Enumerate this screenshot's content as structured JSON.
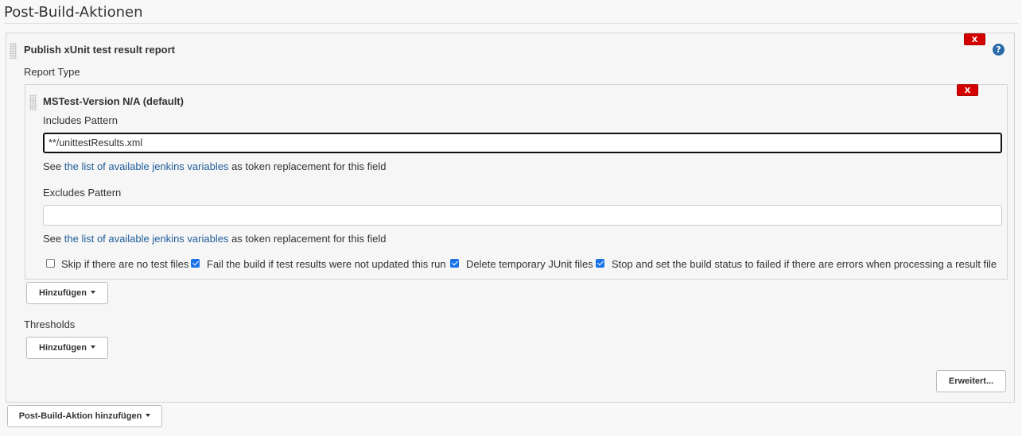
{
  "section": {
    "title": "Post-Build-Aktionen"
  },
  "publisher": {
    "title": "Publish xUnit test result report",
    "delete_label": "X",
    "help_label": "?",
    "report_type_label": "Report Type",
    "report": {
      "title": "MSTest-Version N/A (default)",
      "delete_label": "X",
      "includes": {
        "label": "Includes Pattern",
        "value": "**/unittestResults.xml",
        "hint_prefix": "See",
        "hint_link": "the list of available jenkins variables",
        "hint_suffix": "as token replacement for this field"
      },
      "excludes": {
        "label": "Excludes Pattern",
        "value": "",
        "hint_prefix": "See",
        "hint_link": "the list of available jenkins variables",
        "hint_suffix": "as token replacement for this field"
      },
      "options": [
        {
          "label": "Skip if there are no test files",
          "checked": false
        },
        {
          "label": "Fail the build if test results were not updated this run",
          "checked": true
        },
        {
          "label": "Delete temporary JUnit files",
          "checked": true
        },
        {
          "label": "Stop and set the build status to failed if there are errors when processing a result file",
          "checked": true
        }
      ]
    },
    "report_add_label": "Hinzufügen",
    "thresholds_label": "Thresholds",
    "thresholds_add_label": "Hinzufügen",
    "advanced_label": "Erweitert..."
  },
  "add_post_build_label": "Post-Build-Aktion hinzufügen"
}
